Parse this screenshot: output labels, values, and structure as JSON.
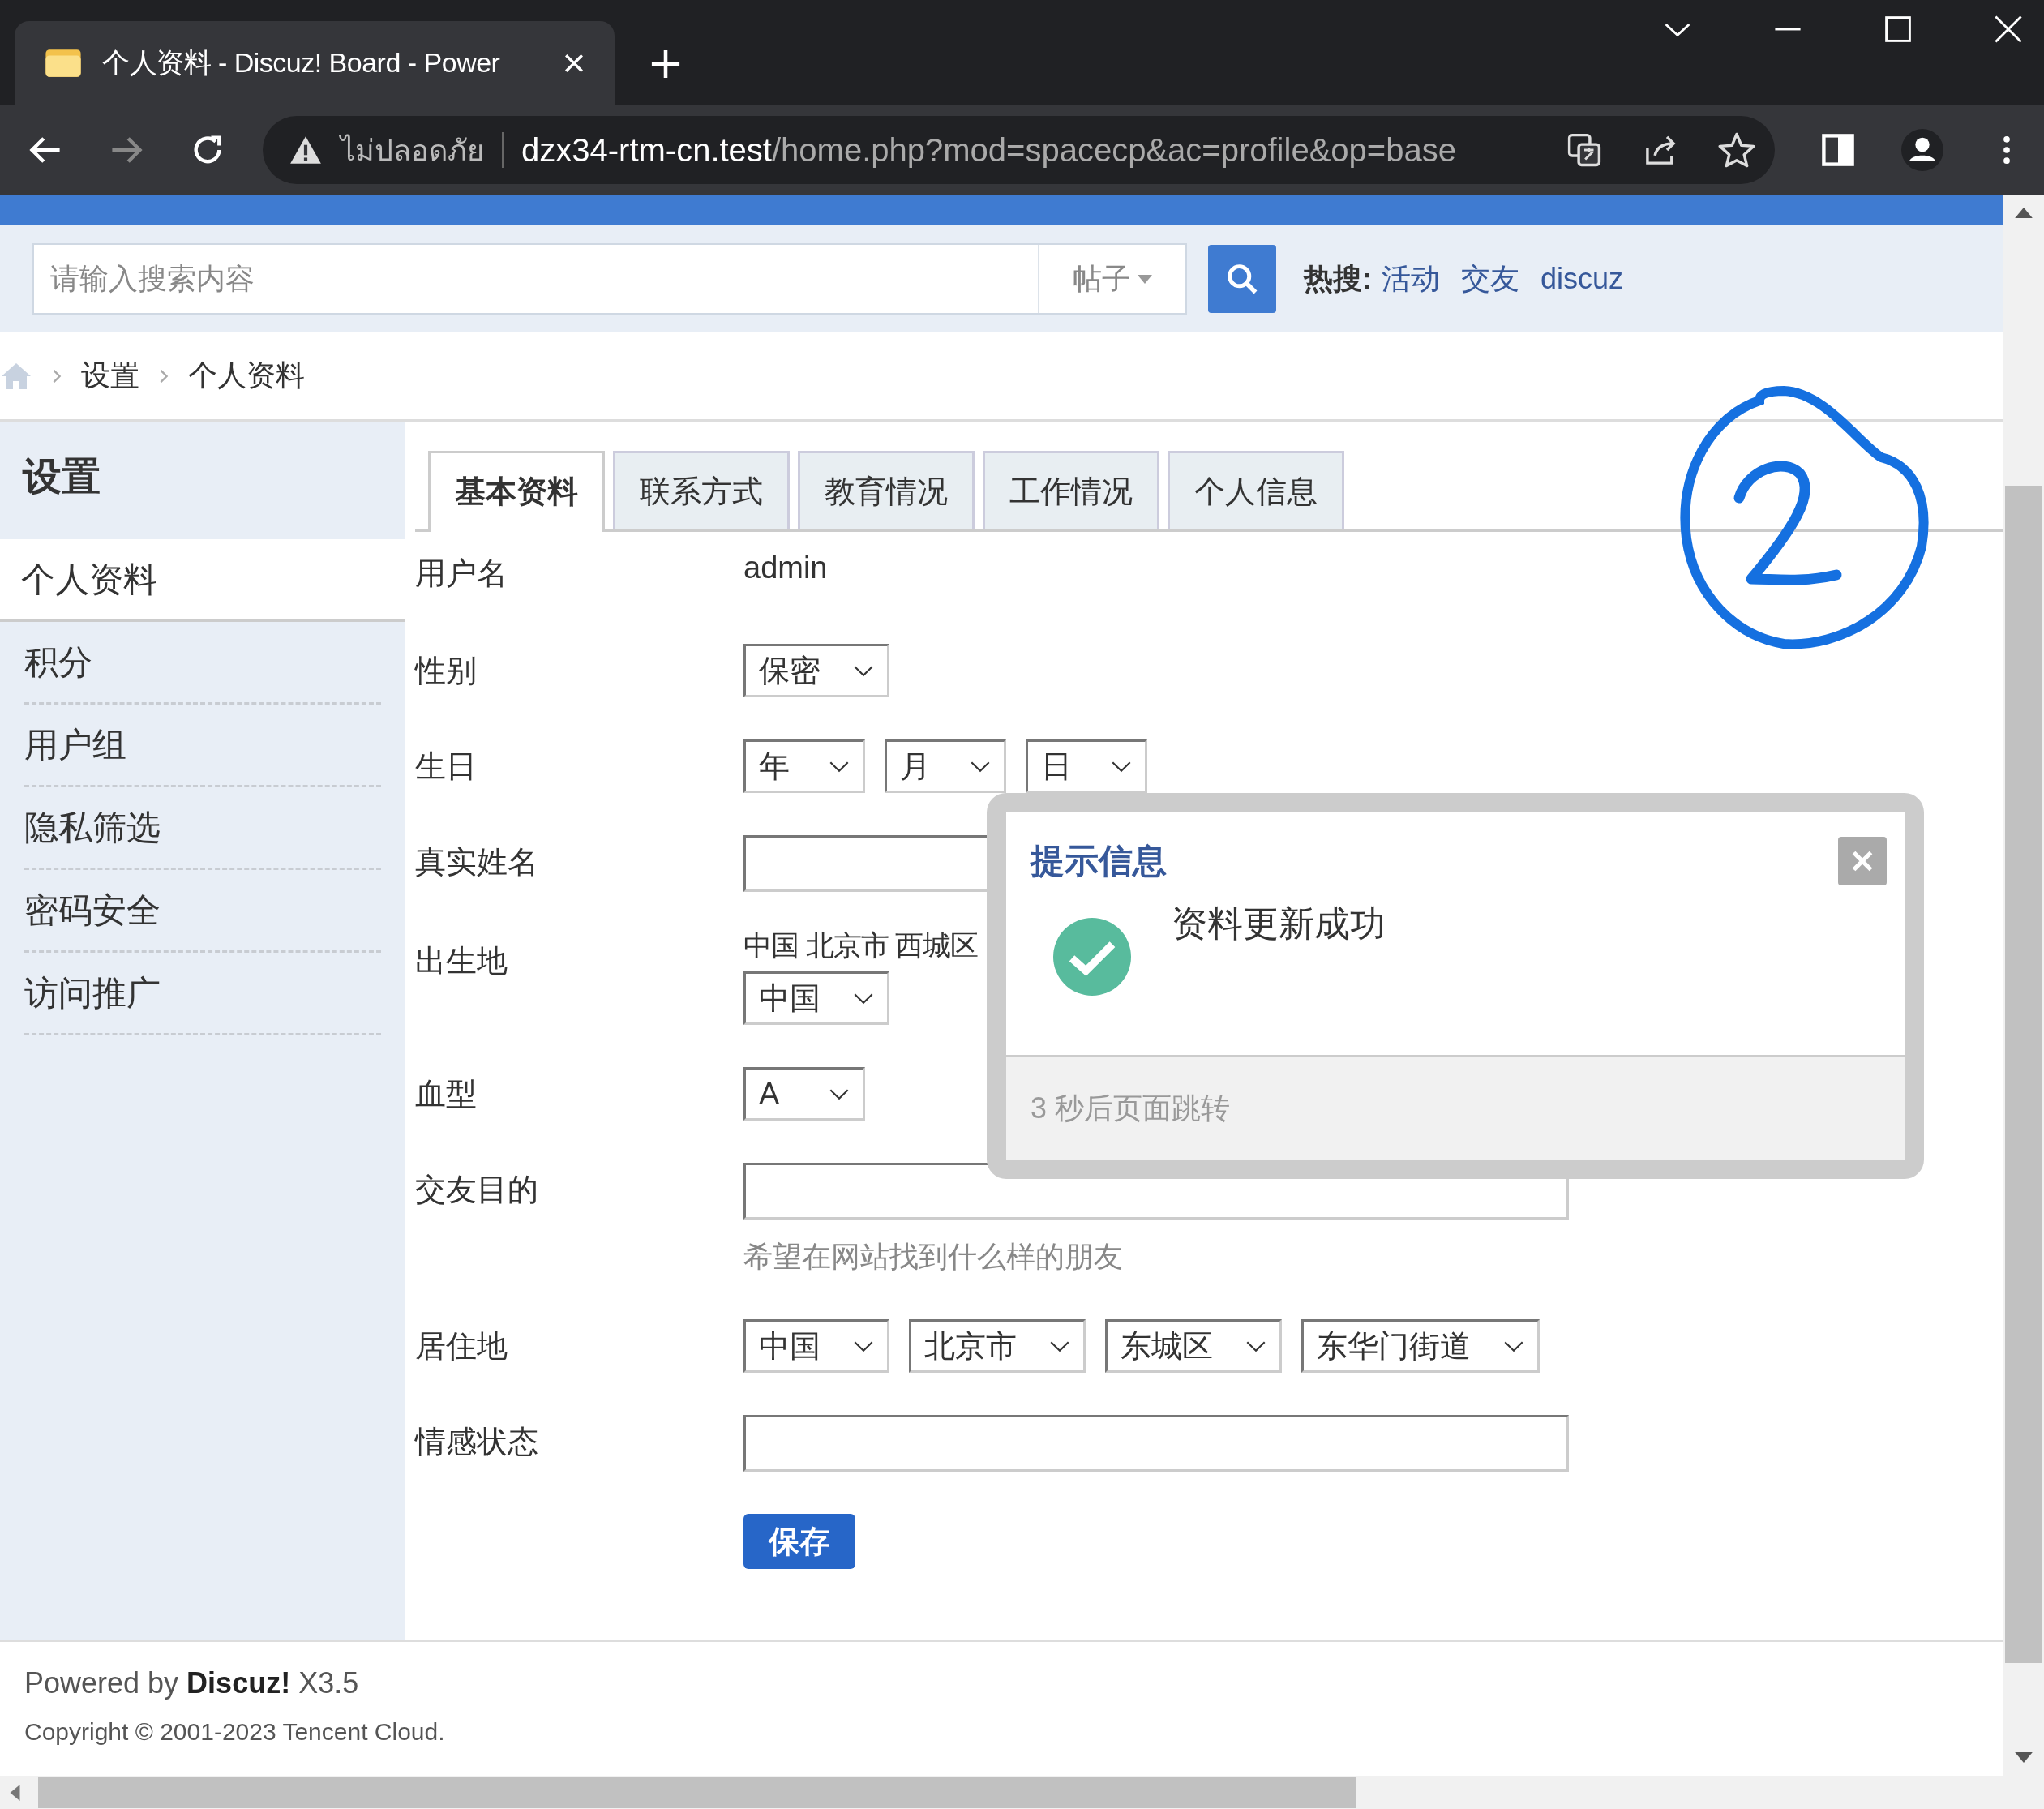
{
  "browser": {
    "tab_title": "个人资料 - Discuz! Board - Power",
    "security_label": "ไม่ปลอดภัย",
    "url_host": "dzx34-rtm-cn.test",
    "url_path": "/home.php?mod=spacecp&ac=profile&op=base"
  },
  "search": {
    "placeholder": "请输入搜索内容",
    "type_label": "帖子",
    "hot_label": "热搜:",
    "hot_links": [
      "活动",
      "交友",
      "discuz"
    ]
  },
  "breadcrumb": [
    "设置",
    "个人资料"
  ],
  "sidebar": {
    "title": "设置",
    "items": [
      {
        "label": "个人资料",
        "selected": true
      },
      {
        "label": "积分",
        "selected": false
      },
      {
        "label": "用户组",
        "selected": false
      },
      {
        "label": "隐私筛选",
        "selected": false
      },
      {
        "label": "密码安全",
        "selected": false
      },
      {
        "label": "访问推广",
        "selected": false
      }
    ]
  },
  "tabs": [
    {
      "label": "基本资料",
      "selected": true
    },
    {
      "label": "联系方式",
      "selected": false
    },
    {
      "label": "教育情况",
      "selected": false
    },
    {
      "label": "工作情况",
      "selected": false
    },
    {
      "label": "个人信息",
      "selected": false
    }
  ],
  "form": [
    {
      "kind": "text",
      "label": "用户名",
      "value": "admin"
    },
    {
      "kind": "selects",
      "label": "性别",
      "selects": [
        "保密"
      ]
    },
    {
      "kind": "selects",
      "label": "生日",
      "selects": [
        "年",
        "月",
        "日"
      ]
    },
    {
      "kind": "input",
      "label": "真实姓名"
    },
    {
      "kind": "region",
      "label": "出生地",
      "value": "中国 北京市 西城区",
      "selects": [
        "中国"
      ]
    },
    {
      "kind": "selects",
      "label": "血型",
      "selects": [
        "A"
      ]
    },
    {
      "kind": "input",
      "label": "交友目的",
      "hint": "希望在网站找到什么样的朋友"
    },
    {
      "kind": "selects",
      "label": "居住地",
      "selects": [
        "中国",
        "北京市",
        "东城区",
        "东华门街道"
      ]
    },
    {
      "kind": "input",
      "label": "情感状态"
    }
  ],
  "save_label": "保存",
  "dialog": {
    "title": "提示信息",
    "message": "资料更新成功",
    "countdown": "3 秒后页面跳转"
  },
  "footer": {
    "powered": "Powered by **Discuz!** X3.5",
    "copyright": "Copyright © 2001-2023 Tencent Cloud."
  }
}
